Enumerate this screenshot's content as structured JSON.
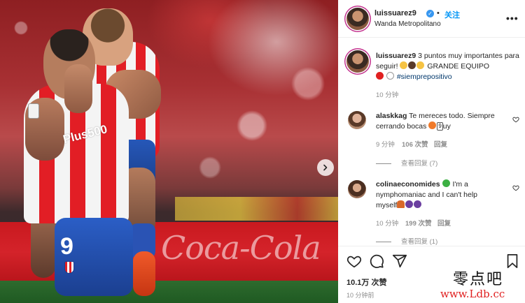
{
  "post": {
    "author": "luissuarez9",
    "follow_label": "关注",
    "separator": "•",
    "location": "Wanda Metropolitano",
    "more_label": "•••"
  },
  "photo": {
    "sponsor_text": "Plus500",
    "shirt_number": "9",
    "ad_text": "Coca-Cola"
  },
  "caption": {
    "username": "luissuarez9",
    "text_part1": "3 puntos muy importantes para seguir!",
    "text_part2": "GRANDE EQUIPO",
    "hashtag": "#siemprepositivo",
    "time": "10 分钟"
  },
  "comments": [
    {
      "username": "alaskkag",
      "text_line1": "Te mereces todo. Siempre",
      "text_line2": "cerrando bocas",
      "text_suffix": "uy",
      "time": "9 分钟",
      "likes": "106 次赞",
      "reply_label": "回复",
      "view_replies": "查看回复 (7)"
    },
    {
      "username": "colinaeconomides",
      "text_line1": "I'm a",
      "text_line2": "nymphomaniac and I can't help",
      "text_line3": "myself",
      "time": "10 分钟",
      "likes": "199 次赞",
      "reply_label": "回复",
      "view_replies": "查看回复 (1)"
    }
  ],
  "engagement": {
    "likes": "10.1万 次赞",
    "time": "10 分钟前"
  },
  "watermark": {
    "cn": "零点吧",
    "url": "www.Ldb.cc"
  },
  "colors": {
    "accent": "#0095f6",
    "verified": "#3897f0",
    "text": "#262626",
    "muted": "#8e8e8e",
    "hashtag": "#00376b"
  }
}
